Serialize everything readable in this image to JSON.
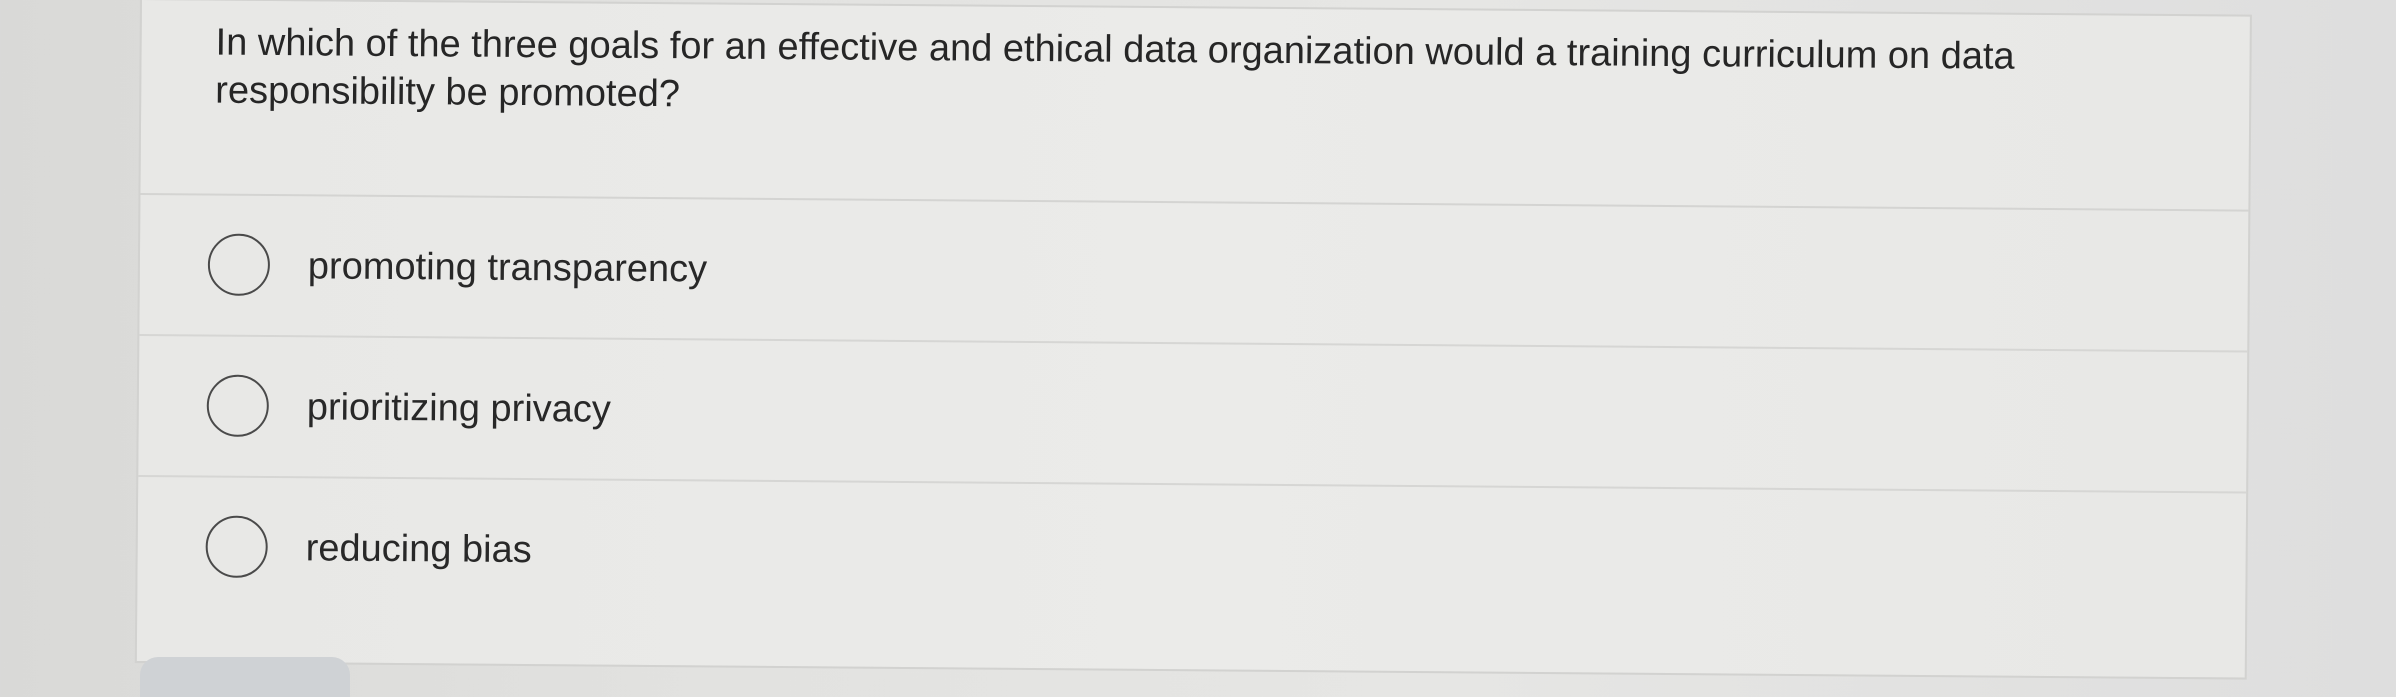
{
  "question": {
    "text": "In which of the three goals for an effective and ethical data organization would a training curriculum on data responsibility be promoted?"
  },
  "options": [
    {
      "label": "promoting transparency",
      "selected": false
    },
    {
      "label": "prioritizing privacy",
      "selected": false
    },
    {
      "label": "reducing bias",
      "selected": false
    }
  ]
}
